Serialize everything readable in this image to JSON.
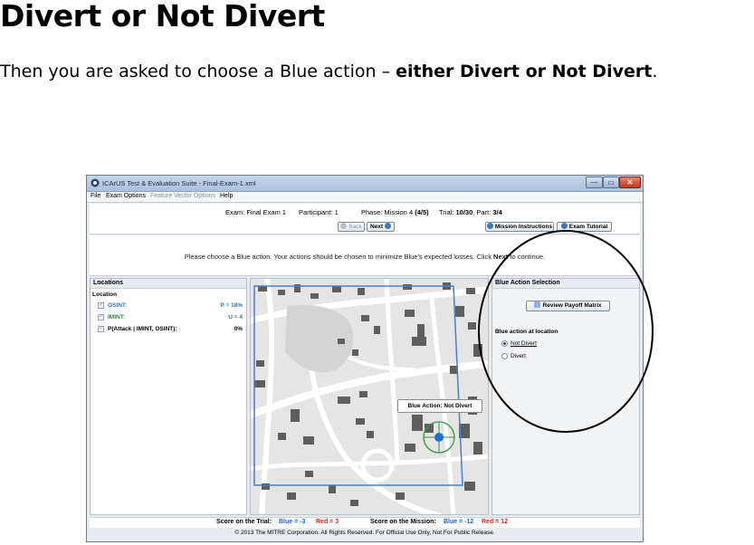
{
  "slide": {
    "title": "Divert or Not Divert",
    "subtitle_prefix": "Then you are asked to choose a Blue action – ",
    "subtitle_bold": "either Divert or Not Divert",
    "subtitle_suffix": "."
  },
  "window": {
    "title": "ICArUS Test & Evaluation Suite - Final-Exam-1.xml",
    "min_glyph": "—",
    "max_glyph": "▭",
    "close_glyph": "✕"
  },
  "menu": {
    "file": "File",
    "exam_options": "Exam Options",
    "feature_vector_options": "Feature Vector Options",
    "help": "Help"
  },
  "info": {
    "exam": "Exam: Final Exam 1",
    "participant": "Participant: 1",
    "phase_prefix": "Phase: Mission 4 ",
    "phase_bold": "(4/5)",
    "trial_prefix": "Trial: ",
    "trial_bold": "10/30",
    "part_prefix": ", Part: ",
    "part_bold": "3/4",
    "back_label": "Back",
    "next_label": "Next",
    "mission_instructions_label": "Mission Instructions",
    "exam_tutorial_label": "Exam Tutorial"
  },
  "message": {
    "before": "Please choose a Blue action. Your actions should be chosen to minimize Blue's expected losses. Click ",
    "bold": "Next",
    "after": " to continue."
  },
  "locations": {
    "header": "Locations",
    "section": "Location",
    "osint_label": "OSINT:",
    "osint_value": "P = 18%",
    "imint_label": "IMINT:",
    "imint_value": "U = 4",
    "pattack_label": "P(Attack | IMINT, OSINT):",
    "pattack_value": "0%",
    "osint_color": "#3a6fc4",
    "imint_color": "#2c8a3c"
  },
  "map": {
    "callout": "Blue Action: Not Divert",
    "boundary_color": "#4a7fc9",
    "marker_color": "#1f6fd1",
    "ring_color": "#2f9a3a"
  },
  "blue_action": {
    "header": "Blue Action Selection",
    "review_button": "Review Payoff Matrix",
    "group_label": "Blue action at location",
    "options": [
      {
        "label": "Not Divert",
        "selected": true
      },
      {
        "label": "Divert",
        "selected": false
      }
    ]
  },
  "score": {
    "trial_label": "Score on the Trial:",
    "trial_blue": "Blue = -3",
    "trial_red": "Red = 3",
    "mission_label": "Score on the Mission:",
    "mission_blue": "Blue = -12",
    "mission_red": "Red = 12",
    "blue_color": "#1d5fd0",
    "red_color": "#e0201b"
  },
  "footer": "© 2013 The MITRE Corporation. All Rights Reserved. For Official Use Only, Not For Public Release."
}
